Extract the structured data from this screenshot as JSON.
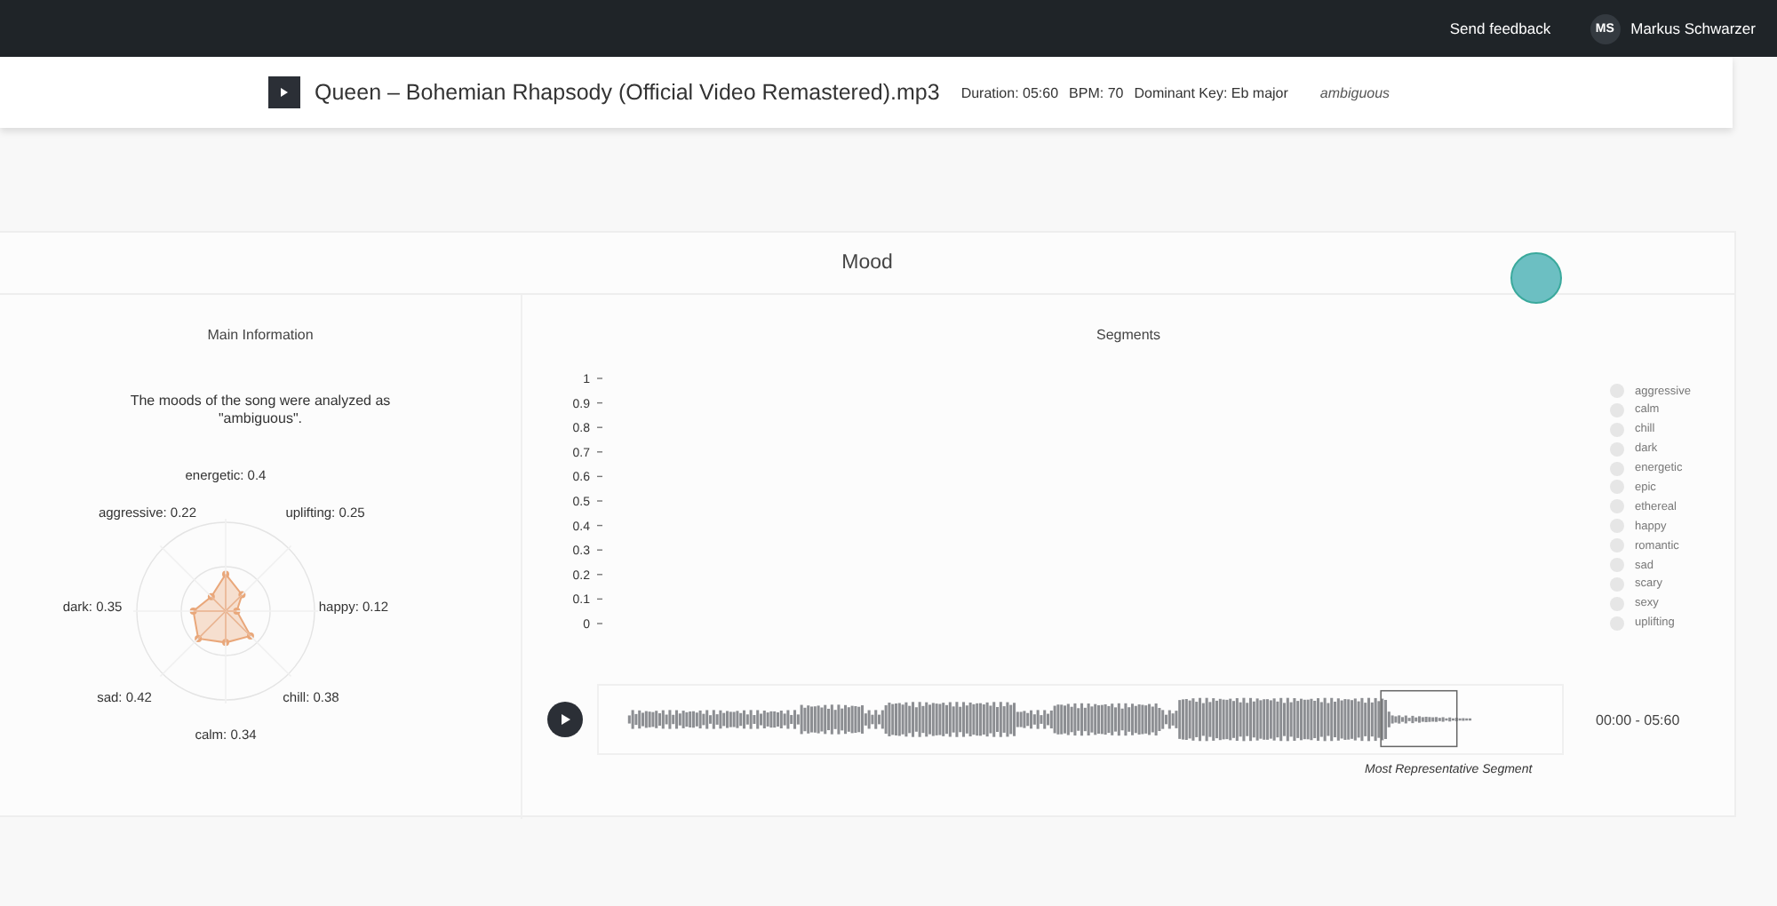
{
  "top_bar": {
    "feedback": "Send feedback",
    "user": {
      "initials": "MS",
      "name": "Markus Schwarzer"
    }
  },
  "track": {
    "title": "Queen – Bohemian Rhapsody (Official Video Remastered).mp3",
    "duration": "Duration: 05:60",
    "bpm": "BPM: 70",
    "key": "Dominant Key: Eb major",
    "mood": "ambiguous"
  },
  "panel": {
    "title": "Mood",
    "main_information": {
      "heading": "Main Information",
      "summary": "The moods of the song were analyzed as \"ambiguous\".",
      "moods": [
        {
          "label": "energetic: 0.4",
          "level": 0.4
        },
        {
          "label": "uplifting: 0.25",
          "level": 0.25
        },
        {
          "label": "happy: 0.12",
          "level": 0.12
        },
        {
          "label": "chill: 0.38",
          "level": 0.38
        },
        {
          "label": "calm: 0.34",
          "level": 0.34
        },
        {
          "label": "sad: 0.42",
          "level": 0.42
        },
        {
          "label": "dark: 0.35",
          "level": 0.35
        },
        {
          "label": "aggressive: 0.22",
          "level": 0.22
        }
      ]
    },
    "segments": {
      "heading": "Segments",
      "y_axis_labels": [
        "1",
        "0.9",
        "0.8",
        "0.7",
        "0.6",
        "0.5",
        "0.4",
        "0.3",
        "0.2",
        "0.1",
        "0"
      ],
      "legend": [
        "aggressive",
        "calm",
        "chill",
        "dark",
        "energetic",
        "epic",
        "ethereal",
        "happy",
        "romantic",
        "sad",
        "scary",
        "sexy",
        "uplifting"
      ],
      "time": "00:00 - 05:60",
      "segment_caption": "Most Representative Segment"
    }
  }
}
